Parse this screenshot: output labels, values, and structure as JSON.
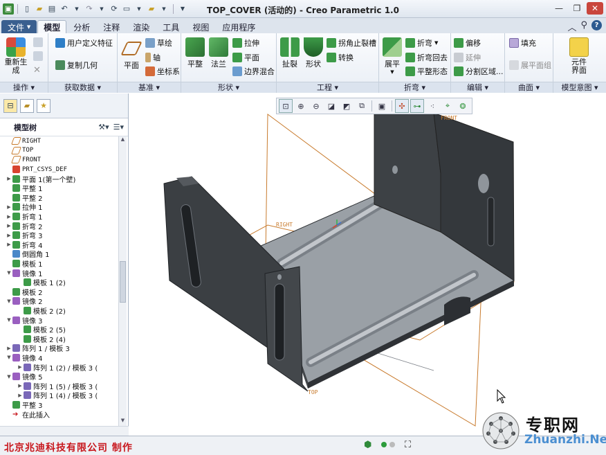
{
  "window": {
    "title": "TOP_COVER (活动的) - Creo Parametric 1.0"
  },
  "tabs": [
    "文件",
    "模型",
    "分析",
    "注释",
    "渲染",
    "工具",
    "视图",
    "应用程序"
  ],
  "active_tab": "模型",
  "ribbon": {
    "operations": {
      "label": "操作",
      "regenerate": "重新生成"
    },
    "get_data": {
      "label": "获取数据",
      "udf": "用户定义特征",
      "copy_geom": "复制几何"
    },
    "datum": {
      "label": "基准",
      "plane": "平面",
      "sketch": "草绘",
      "axis": "轴",
      "csys": "坐标系"
    },
    "shapes": {
      "label": "形状",
      "flat": "平整",
      "flange": "法兰",
      "extrude": "拉伸",
      "plane": "平面",
      "blend": "边界混合"
    },
    "engineering": {
      "label": "工程",
      "rip": "扯裂",
      "form": "形状",
      "corner_relief": "拐角止裂槽",
      "convert": "转换"
    },
    "bends": {
      "label": "折弯",
      "unbend": "展平",
      "bend": "折弯",
      "bend_back": "折弯回去",
      "flatten_form": "平整形态"
    },
    "editing": {
      "label": "编辑",
      "offset": "偏移",
      "extend": "延伸",
      "split_area": "分割区域..."
    },
    "surfaces": {
      "label": "曲面",
      "fill": "填充",
      "flatten_quilt": "展平面组"
    },
    "model_intent": {
      "label": "模型意图",
      "component_interface": "元件界面"
    }
  },
  "model_tree": {
    "header": "模型树",
    "items": [
      {
        "label": "RIGHT",
        "mono": true,
        "exp": "",
        "indent": 0,
        "icon": "plane"
      },
      {
        "label": "TOP",
        "mono": true,
        "exp": "",
        "indent": 0,
        "icon": "plane"
      },
      {
        "label": "FRONT",
        "mono": true,
        "exp": "",
        "indent": 0,
        "icon": "plane"
      },
      {
        "label": "PRT_CSYS_DEF",
        "mono": true,
        "exp": "",
        "indent": 0,
        "icon": "csys"
      },
      {
        "label": "平面 1(第一个壁)",
        "exp": "▶",
        "indent": 0,
        "icon": "wall"
      },
      {
        "label": "平整 1",
        "exp": "",
        "indent": 0,
        "icon": "wall"
      },
      {
        "label": "平整 2",
        "exp": "",
        "indent": 0,
        "icon": "wall"
      },
      {
        "label": "拉伸 1",
        "exp": "▶",
        "indent": 0,
        "icon": "extrude"
      },
      {
        "label": "折弯 1",
        "exp": "▶",
        "indent": 0,
        "icon": "bend"
      },
      {
        "label": "折弯 2",
        "exp": "▶",
        "indent": 0,
        "icon": "bend"
      },
      {
        "label": "折弯 3",
        "exp": "▶",
        "indent": 0,
        "icon": "bend"
      },
      {
        "label": "折弯 4",
        "exp": "▶",
        "indent": 0,
        "icon": "bend"
      },
      {
        "label": "倒圆角 1",
        "exp": "",
        "indent": 0,
        "icon": "round"
      },
      {
        "label": "模板 1",
        "exp": "",
        "indent": 0,
        "icon": "form"
      },
      {
        "label": "镜像 1",
        "exp": "▼",
        "indent": 0,
        "icon": "mirror"
      },
      {
        "label": "模板 1 (2)",
        "exp": "",
        "indent": 1,
        "icon": "form"
      },
      {
        "label": "模板 2",
        "exp": "",
        "indent": 0,
        "icon": "form"
      },
      {
        "label": "镜像 2",
        "exp": "▼",
        "indent": 0,
        "icon": "mirror"
      },
      {
        "label": "模板 2 (2)",
        "exp": "",
        "indent": 1,
        "icon": "form"
      },
      {
        "label": "镜像 3",
        "exp": "▼",
        "indent": 0,
        "icon": "mirror"
      },
      {
        "label": "模板 2 (5)",
        "exp": "",
        "indent": 1,
        "icon": "form"
      },
      {
        "label": "模板 2 (4)",
        "exp": "",
        "indent": 1,
        "icon": "form"
      },
      {
        "label": "阵列 1 / 模板 3",
        "exp": "▶",
        "indent": 0,
        "icon": "pattern"
      },
      {
        "label": "镜像 4",
        "exp": "▼",
        "indent": 0,
        "icon": "mirror"
      },
      {
        "label": "阵列 1 (2) / 模板 3 (",
        "exp": "▶",
        "indent": 1,
        "icon": "pattern"
      },
      {
        "label": "镜像 5",
        "exp": "▼",
        "indent": 0,
        "icon": "mirror"
      },
      {
        "label": "阵列 1 (5) / 模板 3 (",
        "exp": "▶",
        "indent": 1,
        "icon": "pattern"
      },
      {
        "label": "阵列 1 (4) / 模板 3 (",
        "exp": "▶",
        "indent": 1,
        "icon": "pattern"
      },
      {
        "label": "平整 3",
        "exp": "",
        "indent": 0,
        "icon": "wall"
      },
      {
        "label": "在此插入",
        "exp": "",
        "indent": 0,
        "icon": "insert"
      }
    ]
  },
  "viewport": {
    "datum_labels": {
      "front": "FRONT",
      "right": "RIGHT",
      "top": "TOP"
    }
  },
  "status": {
    "company": "北京兆迪科技有限公司   制作"
  },
  "watermark": {
    "cn": "专职网",
    "en": "Zhuanzhi.Net"
  },
  "colors": {
    "accent": "#3a5f8f",
    "datum_plane": "#c87a2c",
    "sheet_metal": "#3d4145",
    "company_red": "#c8171d"
  }
}
